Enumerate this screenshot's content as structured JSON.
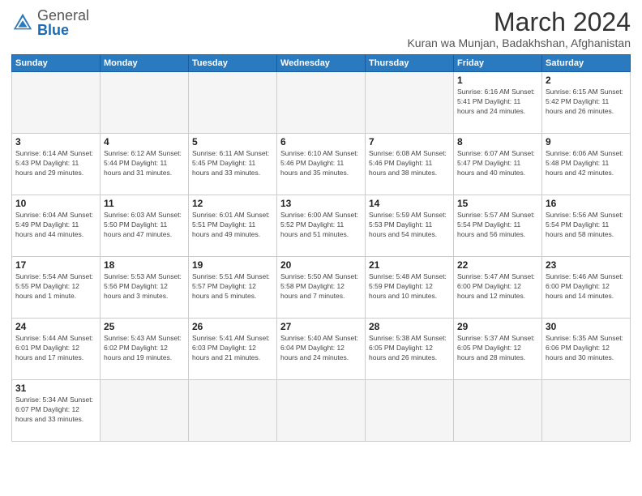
{
  "header": {
    "logo_general": "General",
    "logo_blue": "Blue",
    "title": "March 2024",
    "subtitle": "Kuran wa Munjan, Badakhshan, Afghanistan"
  },
  "days_of_week": [
    "Sunday",
    "Monday",
    "Tuesday",
    "Wednesday",
    "Thursday",
    "Friday",
    "Saturday"
  ],
  "weeks": [
    [
      {
        "day": "",
        "info": ""
      },
      {
        "day": "",
        "info": ""
      },
      {
        "day": "",
        "info": ""
      },
      {
        "day": "",
        "info": ""
      },
      {
        "day": "",
        "info": ""
      },
      {
        "day": "1",
        "info": "Sunrise: 6:16 AM\nSunset: 5:41 PM\nDaylight: 11 hours\nand 24 minutes."
      },
      {
        "day": "2",
        "info": "Sunrise: 6:15 AM\nSunset: 5:42 PM\nDaylight: 11 hours\nand 26 minutes."
      }
    ],
    [
      {
        "day": "3",
        "info": "Sunrise: 6:14 AM\nSunset: 5:43 PM\nDaylight: 11 hours\nand 29 minutes."
      },
      {
        "day": "4",
        "info": "Sunrise: 6:12 AM\nSunset: 5:44 PM\nDaylight: 11 hours\nand 31 minutes."
      },
      {
        "day": "5",
        "info": "Sunrise: 6:11 AM\nSunset: 5:45 PM\nDaylight: 11 hours\nand 33 minutes."
      },
      {
        "day": "6",
        "info": "Sunrise: 6:10 AM\nSunset: 5:46 PM\nDaylight: 11 hours\nand 35 minutes."
      },
      {
        "day": "7",
        "info": "Sunrise: 6:08 AM\nSunset: 5:46 PM\nDaylight: 11 hours\nand 38 minutes."
      },
      {
        "day": "8",
        "info": "Sunrise: 6:07 AM\nSunset: 5:47 PM\nDaylight: 11 hours\nand 40 minutes."
      },
      {
        "day": "9",
        "info": "Sunrise: 6:06 AM\nSunset: 5:48 PM\nDaylight: 11 hours\nand 42 minutes."
      }
    ],
    [
      {
        "day": "10",
        "info": "Sunrise: 6:04 AM\nSunset: 5:49 PM\nDaylight: 11 hours\nand 44 minutes."
      },
      {
        "day": "11",
        "info": "Sunrise: 6:03 AM\nSunset: 5:50 PM\nDaylight: 11 hours\nand 47 minutes."
      },
      {
        "day": "12",
        "info": "Sunrise: 6:01 AM\nSunset: 5:51 PM\nDaylight: 11 hours\nand 49 minutes."
      },
      {
        "day": "13",
        "info": "Sunrise: 6:00 AM\nSunset: 5:52 PM\nDaylight: 11 hours\nand 51 minutes."
      },
      {
        "day": "14",
        "info": "Sunrise: 5:59 AM\nSunset: 5:53 PM\nDaylight: 11 hours\nand 54 minutes."
      },
      {
        "day": "15",
        "info": "Sunrise: 5:57 AM\nSunset: 5:54 PM\nDaylight: 11 hours\nand 56 minutes."
      },
      {
        "day": "16",
        "info": "Sunrise: 5:56 AM\nSunset: 5:54 PM\nDaylight: 11 hours\nand 58 minutes."
      }
    ],
    [
      {
        "day": "17",
        "info": "Sunrise: 5:54 AM\nSunset: 5:55 PM\nDaylight: 12 hours\nand 1 minute."
      },
      {
        "day": "18",
        "info": "Sunrise: 5:53 AM\nSunset: 5:56 PM\nDaylight: 12 hours\nand 3 minutes."
      },
      {
        "day": "19",
        "info": "Sunrise: 5:51 AM\nSunset: 5:57 PM\nDaylight: 12 hours\nand 5 minutes."
      },
      {
        "day": "20",
        "info": "Sunrise: 5:50 AM\nSunset: 5:58 PM\nDaylight: 12 hours\nand 7 minutes."
      },
      {
        "day": "21",
        "info": "Sunrise: 5:48 AM\nSunset: 5:59 PM\nDaylight: 12 hours\nand 10 minutes."
      },
      {
        "day": "22",
        "info": "Sunrise: 5:47 AM\nSunset: 6:00 PM\nDaylight: 12 hours\nand 12 minutes."
      },
      {
        "day": "23",
        "info": "Sunrise: 5:46 AM\nSunset: 6:00 PM\nDaylight: 12 hours\nand 14 minutes."
      }
    ],
    [
      {
        "day": "24",
        "info": "Sunrise: 5:44 AM\nSunset: 6:01 PM\nDaylight: 12 hours\nand 17 minutes."
      },
      {
        "day": "25",
        "info": "Sunrise: 5:43 AM\nSunset: 6:02 PM\nDaylight: 12 hours\nand 19 minutes."
      },
      {
        "day": "26",
        "info": "Sunrise: 5:41 AM\nSunset: 6:03 PM\nDaylight: 12 hours\nand 21 minutes."
      },
      {
        "day": "27",
        "info": "Sunrise: 5:40 AM\nSunset: 6:04 PM\nDaylight: 12 hours\nand 24 minutes."
      },
      {
        "day": "28",
        "info": "Sunrise: 5:38 AM\nSunset: 6:05 PM\nDaylight: 12 hours\nand 26 minutes."
      },
      {
        "day": "29",
        "info": "Sunrise: 5:37 AM\nSunset: 6:05 PM\nDaylight: 12 hours\nand 28 minutes."
      },
      {
        "day": "30",
        "info": "Sunrise: 5:35 AM\nSunset: 6:06 PM\nDaylight: 12 hours\nand 30 minutes."
      }
    ],
    [
      {
        "day": "31",
        "info": "Sunrise: 5:34 AM\nSunset: 6:07 PM\nDaylight: 12 hours\nand 33 minutes."
      },
      {
        "day": "",
        "info": ""
      },
      {
        "day": "",
        "info": ""
      },
      {
        "day": "",
        "info": ""
      },
      {
        "day": "",
        "info": ""
      },
      {
        "day": "",
        "info": ""
      },
      {
        "day": "",
        "info": ""
      }
    ]
  ]
}
